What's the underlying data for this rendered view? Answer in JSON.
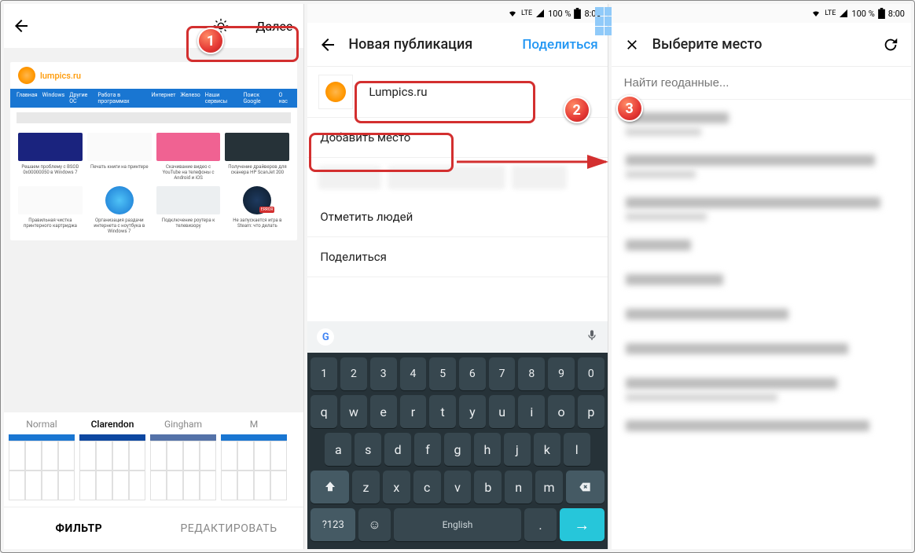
{
  "status": {
    "lte": "LTE",
    "signal": "▲",
    "battery": "100 %",
    "time": "8:00"
  },
  "screen1": {
    "next": "Далее",
    "site_name": "lumpics.ru",
    "nav": [
      "Главная",
      "Windows",
      "Другие ОС",
      "Работа в программах",
      "Интернет",
      "Железо",
      "Наши сервисы",
      "Поиск Google",
      "О нас"
    ],
    "articles_row1": [
      "Решаем проблему с BSOD 0x00000050 в Windows 7",
      "Печать книги на принтере",
      "Скачивание видео с YouTube на телефоны с Android и iOS",
      "Получение драйверов для сканера HP ScanJet 200"
    ],
    "articles_row2": [
      "Правильная чистка принтерного картриджа",
      "Организация раздачи интернета с ноутбука в Windows 7",
      "Подключение роутера к телевизору",
      "Не запускается игра в Steam: что делать"
    ],
    "filters": [
      "Normal",
      "Clarendon",
      "Gingham",
      "M"
    ],
    "tab_filter": "ФИЛЬТР",
    "tab_edit": "РЕДАКТИРОВАТЬ"
  },
  "screen2": {
    "title": "Новая публикация",
    "share": "Поделиться",
    "caption": "Lumpics.ru",
    "add_location": "Добавить место",
    "tag_people": "Отметить людей",
    "share_row": "Поделиться",
    "kbd_lang": "English",
    "kbd_123": "?123"
  },
  "screen3": {
    "title": "Выберите место",
    "placeholder": "Найти геоданные..."
  },
  "badges": {
    "b1": "1",
    "b2": "2",
    "b3": "3"
  }
}
